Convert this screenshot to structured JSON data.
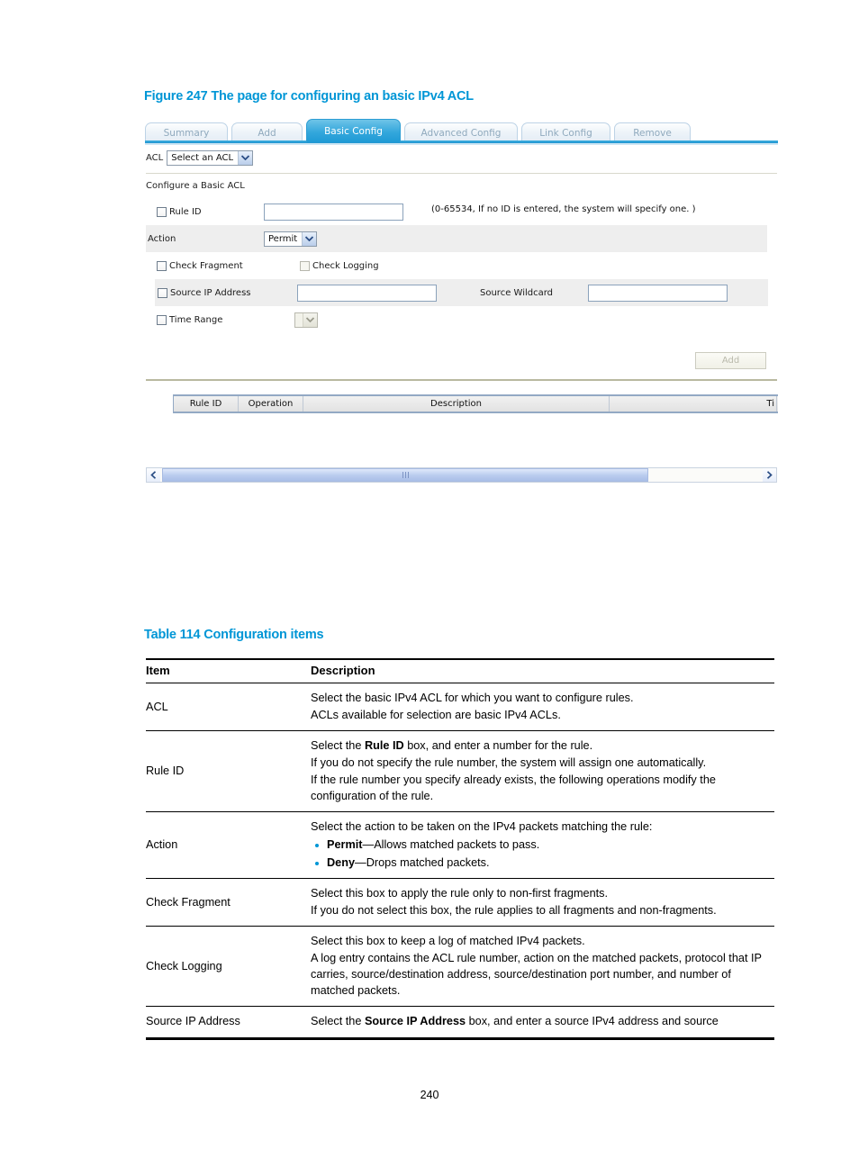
{
  "figure": {
    "caption": "Figure 247 The page for configuring an basic IPv4 ACL"
  },
  "screenshot": {
    "tabs": [
      {
        "label": "Summary",
        "active": false
      },
      {
        "label": "Add",
        "active": false
      },
      {
        "label": "Basic Config",
        "active": true
      },
      {
        "label": "Advanced Config",
        "active": false
      },
      {
        "label": "Link Config",
        "active": false
      },
      {
        "label": "Remove",
        "active": false
      }
    ],
    "acl_row": {
      "label": "ACL",
      "selected": "Select an ACL"
    },
    "form": {
      "title": "Configure a Basic ACL",
      "rule_id": {
        "label": "Rule ID",
        "value": "",
        "hint": "(0-65534, If no ID is entered, the system will specify one. )"
      },
      "action": {
        "label": "Action",
        "selected": "Permit"
      },
      "check_fragment": {
        "label": "Check Fragment",
        "checked": false
      },
      "check_logging": {
        "label": "Check Logging",
        "checked": false
      },
      "source_ip": {
        "label": "Source IP Address",
        "value": ""
      },
      "source_wildcard": {
        "label": "Source Wildcard",
        "value": ""
      },
      "time_range": {
        "label": "Time Range",
        "selected": ""
      },
      "add_button": "Add"
    },
    "rule_table": {
      "columns": [
        "Rule ID",
        "Operation",
        "Description",
        "",
        "Ti"
      ]
    }
  },
  "table114": {
    "caption": "Table 114 Configuration items",
    "headers": {
      "item": "Item",
      "description": "Description"
    },
    "rows": [
      {
        "item": "ACL",
        "lines": [
          "Select the basic IPv4 ACL for which you want to configure rules.",
          "ACLs available for selection are basic IPv4 ACLs."
        ]
      },
      {
        "item": "Rule ID",
        "lines_html": [
          "Select the <b>Rule ID</b> box, and enter a number for the rule.",
          "If you do not specify the rule number, the system will assign one automatically.",
          "If the rule number you specify already exists, the following operations modify the configuration of the rule."
        ]
      },
      {
        "item": "Action",
        "lines": [
          "Select the action to be taken on the IPv4 packets matching the rule:"
        ],
        "bullets_html": [
          "<b>Permit</b>—Allows matched packets to pass.",
          "<b>Deny</b>—Drops matched packets."
        ]
      },
      {
        "item": "Check Fragment",
        "lines": [
          "Select this box to apply the rule only to non-first fragments.",
          "If you do not select this box, the rule applies to all fragments and non-fragments."
        ]
      },
      {
        "item": "Check Logging",
        "lines": [
          "Select this box to keep a log of matched IPv4 packets.",
          "A log entry contains the ACL rule number, action on the matched packets, protocol that IP carries, source/destination address, source/destination port number, and number of matched packets."
        ]
      },
      {
        "item": "Source IP Address",
        "lines_html": [
          "Select the <b>Source IP Address</b> box, and enter a source IPv4 address and source"
        ]
      }
    ]
  },
  "page_number": "240",
  "colors": {
    "accent": "#0096d6",
    "tab_active_bg": "#2da4db",
    "tab_inactive_text": "#8fa9bd"
  }
}
